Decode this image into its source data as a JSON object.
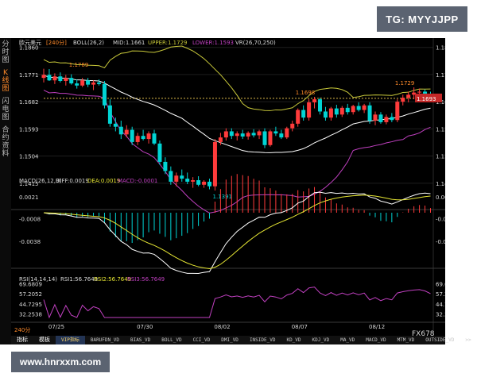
{
  "watermarks": {
    "top": "TG: MYYJJPP",
    "bottom": "www.hnrxxm.com"
  },
  "side_tabs": [
    {
      "label": "分时图",
      "active": false
    },
    {
      "label": "K线图",
      "active": true
    },
    {
      "label": "闪电图",
      "active": false
    },
    {
      "label": "合约资料",
      "active": false
    }
  ],
  "header": {
    "symbol": "欧元美元",
    "period": "[240分]",
    "boll": "BOLL(26,2)",
    "mid": "MID:1.1661",
    "upper": "UPPER:1.1729",
    "lower": "LOWER:1.1593",
    "vr": "VR(26,70,250)"
  },
  "macd_header": {
    "name": "MACD(26,12,9)",
    "diff": "DIFF:0.0019",
    "dea": "DEA:0.0019",
    "macd": "MACD:-0.0001"
  },
  "rsi_header": {
    "name": "RSI(14,14,14)",
    "rsi1": "RSI1:56.7649",
    "rsi2": "RSI2:56.7649",
    "rsi3": "RSI3:56.7649"
  },
  "bottom_bar": {
    "period": "240分",
    "tabs": [
      "指标",
      "模板",
      "VIP指标",
      "BARUFDN_VD",
      "BIAS_VD",
      "BOLL_VD",
      "CCI_VD",
      "DMI_VD",
      "INSIDE_VD",
      "KD_VD",
      "KDJ_VD",
      "MA_VD",
      "MACD_VD",
      "MTM_VD",
      "OUTSIDE_VD",
      ">>"
    ],
    "selected": 2,
    "code": "FX678"
  },
  "colors": {
    "up": "#ff3b3b",
    "down": "#00d4d4",
    "mid": "#ffffff",
    "upper": "#c9c93a",
    "lower": "#c040c0",
    "diff": "#ffffff",
    "dea": "#e6e633",
    "rsi": "#c040c0",
    "label": "#ff8a2a"
  },
  "chart_data": [
    {
      "type": "candlestick",
      "title": "欧元美元 [240分]",
      "x_tick_labels": [
        "07/25",
        "07/30",
        "08/02",
        "08/07",
        "08/12"
      ],
      "y_ticks": [
        "1.1860",
        "1.1771",
        "1.1682",
        "1.1593",
        "1.1504",
        "1.1415"
      ],
      "ylim": [
        1.136,
        1.188
      ],
      "current_price": 1.1693,
      "annotations": [
        {
          "text": "1.1789",
          "value": 1.1789
        },
        {
          "text": "1.1391",
          "value": 1.1391
        },
        {
          "text": "1.1698",
          "value": 1.1698
        },
        {
          "text": "1.1729",
          "value": 1.1729
        }
      ],
      "ohlc": [
        [
          1.176,
          1.179,
          1.1745,
          1.177
        ],
        [
          1.177,
          1.1789,
          1.175,
          1.1752
        ],
        [
          1.1752,
          1.1775,
          1.174,
          1.1765
        ],
        [
          1.1765,
          1.1778,
          1.1745,
          1.175
        ],
        [
          1.175,
          1.177,
          1.1735,
          1.176
        ],
        [
          1.176,
          1.1772,
          1.1738,
          1.1742
        ],
        [
          1.1742,
          1.1755,
          1.1725,
          1.1735
        ],
        [
          1.1735,
          1.176,
          1.173,
          1.1752
        ],
        [
          1.1752,
          1.176,
          1.173,
          1.1738
        ],
        [
          1.1738,
          1.1752,
          1.172,
          1.1745
        ],
        [
          1.1745,
          1.1755,
          1.1735,
          1.174
        ],
        [
          1.174,
          1.175,
          1.166,
          1.167
        ],
        [
          1.167,
          1.169,
          1.16,
          1.161
        ],
        [
          1.161,
          1.163,
          1.1585,
          1.16
        ],
        [
          1.16,
          1.162,
          1.156,
          1.1575
        ],
        [
          1.1575,
          1.1605,
          1.1565,
          1.159
        ],
        [
          1.159,
          1.16,
          1.154,
          1.155
        ],
        [
          1.155,
          1.158,
          1.154,
          1.157
        ],
        [
          1.157,
          1.159,
          1.1555,
          1.156
        ],
        [
          1.156,
          1.1585,
          1.1545,
          1.1578
        ],
        [
          1.1578,
          1.159,
          1.154,
          1.1545
        ],
        [
          1.1545,
          1.1555,
          1.1475,
          1.1485
        ],
        [
          1.1485,
          1.15,
          1.1445,
          1.1455
        ],
        [
          1.1455,
          1.147,
          1.141,
          1.142
        ],
        [
          1.142,
          1.145,
          1.1405,
          1.144
        ],
        [
          1.144,
          1.146,
          1.142,
          1.143
        ],
        [
          1.143,
          1.145,
          1.1412,
          1.142
        ],
        [
          1.142,
          1.1435,
          1.14,
          1.1425
        ],
        [
          1.1425,
          1.1438,
          1.1405,
          1.141
        ],
        [
          1.141,
          1.1425,
          1.14,
          1.142
        ],
        [
          1.142,
          1.143,
          1.1395,
          1.1405
        ],
        [
          1.1405,
          1.156,
          1.1391,
          1.155
        ],
        [
          1.155,
          1.158,
          1.154,
          1.1565
        ],
        [
          1.1565,
          1.1595,
          1.1555,
          1.1585
        ],
        [
          1.1585,
          1.1595,
          1.156,
          1.157
        ],
        [
          1.157,
          1.1585,
          1.1555,
          1.1578
        ],
        [
          1.1578,
          1.159,
          1.156,
          1.1568
        ],
        [
          1.1568,
          1.1585,
          1.1558,
          1.158
        ],
        [
          1.158,
          1.1592,
          1.1565,
          1.1572
        ],
        [
          1.1572,
          1.159,
          1.156,
          1.1585
        ],
        [
          1.1585,
          1.1595,
          1.153,
          1.154
        ],
        [
          1.154,
          1.159,
          1.1535,
          1.1585
        ],
        [
          1.1585,
          1.16,
          1.157,
          1.1578
        ],
        [
          1.1578,
          1.159,
          1.156,
          1.1565
        ],
        [
          1.1565,
          1.16,
          1.156,
          1.1595
        ],
        [
          1.1595,
          1.162,
          1.1585,
          1.161
        ],
        [
          1.161,
          1.166,
          1.16,
          1.1655
        ],
        [
          1.1655,
          1.167,
          1.162,
          1.163
        ],
        [
          1.163,
          1.169,
          1.162,
          1.168
        ],
        [
          1.168,
          1.1698,
          1.166,
          1.169
        ],
        [
          1.169,
          1.1695,
          1.164,
          1.165
        ],
        [
          1.165,
          1.1665,
          1.162,
          1.163
        ],
        [
          1.163,
          1.1665,
          1.162,
          1.166
        ],
        [
          1.166,
          1.1672,
          1.163,
          1.164
        ],
        [
          1.164,
          1.1668,
          1.1632,
          1.1662
        ],
        [
          1.1662,
          1.1675,
          1.164,
          1.1648
        ],
        [
          1.1648,
          1.1672,
          1.164,
          1.1668
        ],
        [
          1.1668,
          1.168,
          1.165,
          1.1655
        ],
        [
          1.1655,
          1.1675,
          1.1645,
          1.167
        ],
        [
          1.167,
          1.168,
          1.161,
          1.162
        ],
        [
          1.162,
          1.165,
          1.1605,
          1.164
        ],
        [
          1.164,
          1.1648,
          1.161,
          1.1615
        ],
        [
          1.1615,
          1.164,
          1.1608,
          1.1632
        ],
        [
          1.1632,
          1.1645,
          1.1615,
          1.1622
        ],
        [
          1.1622,
          1.169,
          1.1615,
          1.1682
        ],
        [
          1.1682,
          1.1705,
          1.167,
          1.1695
        ],
        [
          1.1695,
          1.1715,
          1.168,
          1.1705
        ],
        [
          1.1705,
          1.1729,
          1.169,
          1.1712
        ],
        [
          1.1712,
          1.1725,
          1.1695,
          1.1715
        ],
        [
          1.1715,
          1.1722,
          1.17,
          1.1708
        ],
        [
          1.1708,
          1.1715,
          1.1685,
          1.1693
        ]
      ]
    },
    {
      "type": "line",
      "title": "MACD(26,12,9)",
      "y_ticks": [
        "0.0021",
        "-0.0008",
        "-0.0038"
      ],
      "ylim": [
        -0.006,
        0.004
      ],
      "series": [
        {
          "name": "DIFF"
        },
        {
          "name": "DEA"
        },
        {
          "name": "MACD"
        }
      ]
    },
    {
      "type": "line",
      "title": "RSI(14,14,14)",
      "y_ticks": [
        "69.6809",
        "57.2052",
        "44.7295",
        "32.2538"
      ],
      "ylim": [
        26,
        75
      ],
      "series": [
        {
          "name": "RSI1"
        }
      ]
    }
  ]
}
